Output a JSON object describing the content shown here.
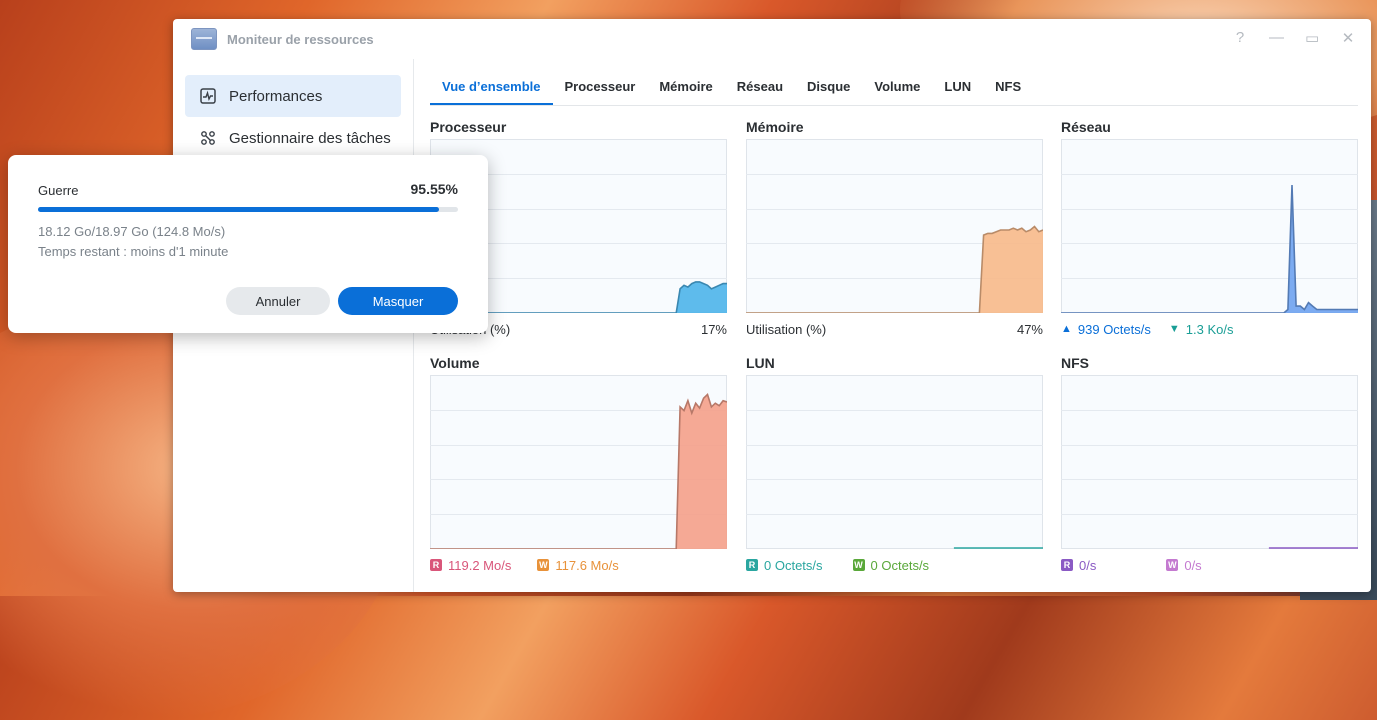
{
  "window": {
    "title": "Moniteur de ressources"
  },
  "sidebar": {
    "items": [
      {
        "label": "Performances",
        "icon": "performance-icon",
        "active": true
      },
      {
        "label": "Gestionnaire des tâches",
        "icon": "task-manager-icon",
        "active": false
      }
    ]
  },
  "tabs": [
    {
      "label": "Vue d’ensemble",
      "active": true
    },
    {
      "label": "Processeur"
    },
    {
      "label": "Mémoire"
    },
    {
      "label": "Réseau"
    },
    {
      "label": "Disque"
    },
    {
      "label": "Volume"
    },
    {
      "label": "LUN"
    },
    {
      "label": "NFS"
    }
  ],
  "panels": {
    "cpu": {
      "title": "Processeur",
      "footer_label": "Utilisation  (%)",
      "value": "17%",
      "color": "#4db4ea",
      "series": [
        0,
        0,
        0,
        0,
        0,
        0,
        0,
        0,
        0,
        0,
        0,
        0,
        0,
        0,
        0,
        0,
        0,
        0,
        0,
        0,
        0,
        0,
        0,
        0,
        0,
        0,
        0,
        0,
        0,
        0,
        0,
        0,
        0,
        0,
        0,
        0,
        0,
        0,
        0,
        0,
        0,
        0,
        0,
        0,
        0,
        0,
        0,
        0,
        0,
        0,
        0,
        0,
        0,
        0,
        0,
        0,
        0,
        0,
        0,
        0,
        0,
        0,
        0,
        0,
        14,
        16,
        15,
        17,
        18,
        18,
        17,
        16,
        14,
        15,
        16,
        17,
        17
      ]
    },
    "memory": {
      "title": "Mémoire",
      "footer_label": "Utilisation  (%)",
      "value": "47%",
      "color": "#f7b98a",
      "series": [
        0,
        0,
        0,
        0,
        0,
        0,
        0,
        0,
        0,
        0,
        0,
        0,
        0,
        0,
        0,
        0,
        0,
        0,
        0,
        0,
        0,
        0,
        0,
        0,
        0,
        0,
        0,
        0,
        0,
        0,
        0,
        0,
        0,
        0,
        0,
        0,
        0,
        0,
        0,
        0,
        0,
        0,
        0,
        0,
        0,
        0,
        0,
        0,
        0,
        0,
        0,
        0,
        0,
        0,
        0,
        0,
        45,
        46,
        46,
        47,
        48,
        48,
        48,
        49,
        48,
        49,
        47,
        48,
        50,
        47,
        48
      ]
    },
    "network": {
      "title": "Réseau",
      "up_label": "939 Octets/s",
      "down_label": "1.3 Ko/s",
      "color": "#6ea2f0",
      "series": [
        0,
        0,
        0,
        0,
        0,
        0,
        0,
        0,
        0,
        0,
        0,
        0,
        0,
        0,
        0,
        0,
        0,
        0,
        0,
        0,
        0,
        0,
        0,
        0,
        0,
        0,
        0,
        0,
        0,
        0,
        0,
        0,
        0,
        0,
        0,
        0,
        0,
        0,
        0,
        0,
        0,
        0,
        0,
        0,
        0,
        0,
        0,
        0,
        0,
        0,
        0,
        0,
        0,
        0,
        0,
        1,
        37,
        2,
        2,
        1,
        3,
        2,
        1,
        1,
        1,
        1,
        1,
        1,
        1,
        1,
        1,
        1,
        1
      ]
    },
    "volume": {
      "title": "Volume",
      "read_label": "119.2 Mo/s",
      "write_label": "117.6 Mo/s",
      "color": "#f4a08a",
      "series": [
        0,
        0,
        0,
        0,
        0,
        0,
        0,
        0,
        0,
        0,
        0,
        0,
        0,
        0,
        0,
        0,
        0,
        0,
        0,
        0,
        0,
        0,
        0,
        0,
        0,
        0,
        0,
        0,
        0,
        0,
        0,
        0,
        0,
        0,
        0,
        0,
        0,
        0,
        0,
        0,
        0,
        0,
        0,
        0,
        0,
        0,
        0,
        0,
        0,
        0,
        0,
        0,
        0,
        0,
        0,
        0,
        0,
        0,
        0,
        0,
        0,
        0,
        0,
        0,
        115,
        112,
        120,
        110,
        118,
        114,
        122,
        125,
        115,
        118,
        116,
        120,
        119
      ]
    },
    "lun": {
      "title": "LUN",
      "read_label": "0 Octets/s",
      "write_label": "0 Octets/s"
    },
    "nfs": {
      "title": "NFS",
      "read_label": "0/s",
      "write_label": "0/s"
    }
  },
  "badges": {
    "read": "R",
    "write": "W"
  },
  "colors": {
    "accent": "#0a6fd8",
    "read_red": "#d9567a",
    "write_orange": "#e8923a",
    "lun_read": "#2aa6a0",
    "lun_write": "#5aa83a",
    "nfs_read": "#8a5ac4",
    "nfs_write": "#c47ad0"
  },
  "dialog": {
    "file_name": "Guerre",
    "percent": "95.55%",
    "progress_fraction": 0.9555,
    "size_line": "18.12 Go/18.97 Go (124.8 Mo/s)",
    "time_line": "Temps restant : moins d'1 minute",
    "cancel_label": "Annuler",
    "hide_label": "Masquer"
  }
}
